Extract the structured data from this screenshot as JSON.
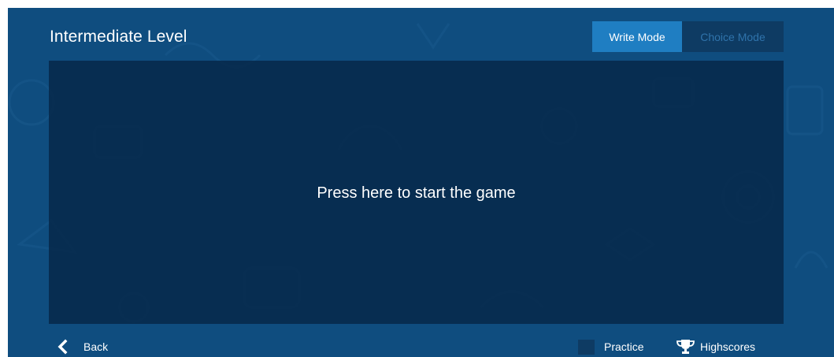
{
  "header": {
    "title": "Intermediate Level"
  },
  "mode_toggle": {
    "write_label": "Write Mode",
    "choice_label": "Choice Mode",
    "selected": "Write Mode"
  },
  "game": {
    "start_prompt": "Press here to start the game"
  },
  "footer": {
    "back_label": "Back",
    "practice_label": "Practice",
    "practice_checked": false,
    "highscores_label": "Highscores"
  },
  "icons": {
    "back": "chevron-left-icon",
    "highscores": "trophy-icon"
  },
  "colors": {
    "background": "#0f4d7f",
    "game_area": "#062a4d",
    "active_mode": "#1f7ec2",
    "inactive_mode": "#0e3b63",
    "inactive_mode_text": "#2f73ab",
    "text": "#ffffff"
  }
}
